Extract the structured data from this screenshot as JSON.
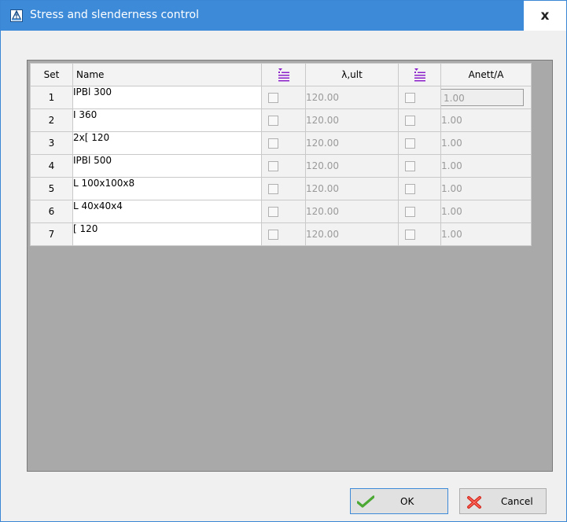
{
  "window": {
    "title": "Stress and slenderness control",
    "close_label": "x"
  },
  "grid": {
    "headers": {
      "set": "Set",
      "name": "Name",
      "lambda": "λ,ult",
      "anett": "Anett/A"
    },
    "rows": [
      {
        "set": "1",
        "name": "IPBl 300",
        "lambda": "120.00",
        "anett": "1.00"
      },
      {
        "set": "2",
        "name": "I 360",
        "lambda": "120.00",
        "anett": "1.00"
      },
      {
        "set": "3",
        "name": "2x[ 120",
        "lambda": "120.00",
        "anett": "1.00"
      },
      {
        "set": "4",
        "name": "IPBl 500",
        "lambda": "120.00",
        "anett": "1.00"
      },
      {
        "set": "5",
        "name": "L 100x100x8",
        "lambda": "120.00",
        "anett": "1.00"
      },
      {
        "set": "6",
        "name": "L 40x40x4",
        "lambda": "120.00",
        "anett": "1.00"
      },
      {
        "set": "7",
        "name": "[ 120",
        "lambda": "120.00",
        "anett": "1.00"
      }
    ]
  },
  "buttons": {
    "ok": "OK",
    "cancel": "Cancel"
  },
  "icons": {
    "app": "app-structure-icon",
    "multi_set": "multi-select-lines-icon",
    "ok": "green-check-icon",
    "cancel": "red-x-icon"
  },
  "colors": {
    "titlebar": "#3c8ad8",
    "grid_background": "#a9a9a9",
    "icon_purple": "#8a1fc9"
  }
}
